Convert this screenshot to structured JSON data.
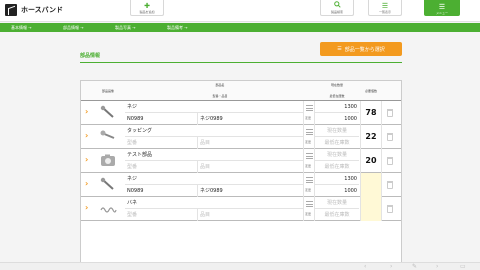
{
  "app": {
    "name": "ホースバンド"
  },
  "header": {
    "add_label": "製品を追加",
    "search_label": "製品検索",
    "list_label": "一覧表示",
    "menu_label": "メニュー"
  },
  "breadcrumbs": [
    "基本情報 →",
    "部品情報 →",
    "製品写真 →",
    "製品備考 →"
  ],
  "section": {
    "title": "部品情報",
    "pick_button": "部品一覧から選択"
  },
  "table": {
    "headers": {
      "image": "部品画像",
      "name": "部品名",
      "model_part": "型番・品目",
      "stock": "現在数量",
      "min_stock": "最低在庫数",
      "required": "必要個数"
    },
    "edit_label": "変更",
    "rows": [
      {
        "name": "ネジ",
        "model": "N0989",
        "part": "ネジ0989",
        "stock": "1300",
        "min_stock": "1000",
        "required": "78",
        "thumb": "screw-image"
      },
      {
        "name": "タッピング",
        "model": "",
        "part": "",
        "stock": "",
        "min_stock": "",
        "required": "22",
        "thumb": "tapping-screw-image"
      },
      {
        "name": "テスト部品",
        "model": "",
        "part": "",
        "stock": "",
        "min_stock": "",
        "required": "20",
        "thumb": "camera-placeholder-image"
      },
      {
        "name": "ネジ",
        "model": "N0989",
        "part": "ネジ0989",
        "stock": "1300",
        "min_stock": "1000",
        "required": "",
        "thumb": "screw-image"
      },
      {
        "name": "バネ",
        "model": "",
        "part": "",
        "stock": "",
        "min_stock": "",
        "required": "",
        "thumb": "spring-image"
      }
    ],
    "placeholders": {
      "model": "型番",
      "part": "品目",
      "stock": "現在数量",
      "min_stock": "最低在庫数"
    }
  },
  "colors": {
    "brand_green": "#4caf32",
    "accent_orange": "#f39a1f"
  }
}
